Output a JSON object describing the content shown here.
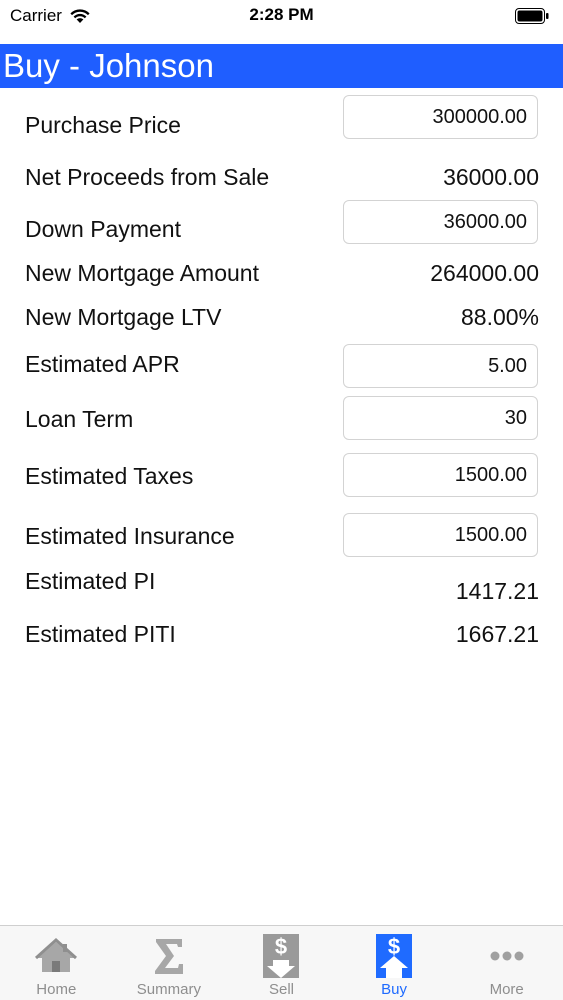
{
  "status_bar": {
    "carrier": "Carrier",
    "time": "2:28 PM",
    "icons": [
      "wifi-icon",
      "battery-icon"
    ]
  },
  "header": {
    "title": "Buy - Johnson",
    "color": "#1f5eff"
  },
  "form": {
    "purchase_price": {
      "label": "Purchase Price",
      "value": "300000.00"
    },
    "net_proceeds": {
      "label": "Net Proceeds from Sale",
      "value": "36000.00"
    },
    "down_payment": {
      "label": "Down Payment",
      "value": "36000.00"
    },
    "new_mortgage_amount": {
      "label": "New Mortgage Amount",
      "value": "264000.00"
    },
    "new_mortgage_ltv": {
      "label": "New Mortgage LTV",
      "value": "88.00%"
    },
    "estimated_apr": {
      "label": "Estimated APR",
      "value": "5.00"
    },
    "loan_term": {
      "label": "Loan Term",
      "value": "30"
    },
    "estimated_taxes": {
      "label": "Estimated Taxes",
      "value": "1500.00"
    },
    "estimated_insurance": {
      "label": "Estimated Insurance",
      "value": "1500.00"
    },
    "estimated_pi": {
      "label": "Estimated PI",
      "value": "1417.21"
    },
    "estimated_piti": {
      "label": "Estimated PITI",
      "value": "1667.21"
    }
  },
  "tab_bar": {
    "active_color": "#1f6bff",
    "tabs": [
      {
        "label": "Home",
        "icon": "home-icon"
      },
      {
        "label": "Summary",
        "icon": "sigma-icon"
      },
      {
        "label": "Sell",
        "icon": "dollar-down-arrow-icon"
      },
      {
        "label": "Buy",
        "icon": "dollar-up-arrow-icon",
        "active": true
      },
      {
        "label": "More",
        "icon": "more-dots-icon"
      }
    ]
  }
}
